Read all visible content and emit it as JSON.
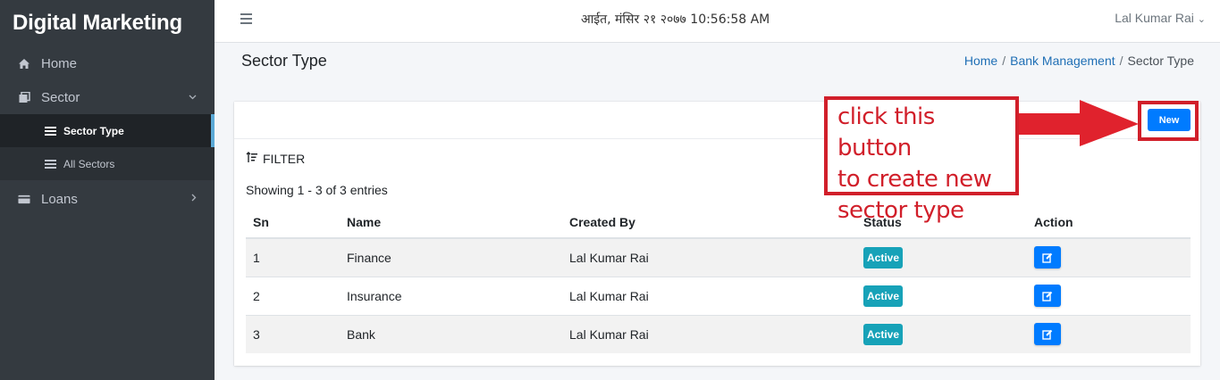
{
  "app": {
    "brand": "Digital Marketing"
  },
  "sidebar": {
    "items": [
      {
        "label": "Home",
        "icon": "home-icon"
      },
      {
        "label": "Sector",
        "icon": "copy-icon",
        "chevron": "chevron-down-icon"
      },
      {
        "label": "Loans",
        "icon": "credit-card-icon",
        "chevron": "chevron-right-icon"
      }
    ],
    "sub_items": [
      {
        "label": "Sector Type",
        "active": true
      },
      {
        "label": "All Sectors",
        "active": false
      }
    ]
  },
  "topbar": {
    "datetime": "आईत, मंसिर २१ २०७७ 10:56:58 AM",
    "user": "Lal Kumar Rai",
    "user_caret": "⌄"
  },
  "header": {
    "title": "Sector Type",
    "breadcrumb": [
      "Home",
      "Bank Management",
      "Sector Type"
    ]
  },
  "card": {
    "new_button": "New",
    "filter_label": "FILTER",
    "entries_text": "Showing 1 - 3 of 3 entries"
  },
  "table": {
    "columns": [
      "Sn",
      "Name",
      "Created By",
      "Status",
      "Action"
    ],
    "rows": [
      {
        "sn": "1",
        "name": "Finance",
        "created_by": "Lal Kumar Rai",
        "status": "Active"
      },
      {
        "sn": "2",
        "name": "Insurance",
        "created_by": "Lal Kumar Rai",
        "status": "Active"
      },
      {
        "sn": "3",
        "name": "Bank",
        "created_by": "Lal Kumar Rai",
        "status": "Active"
      }
    ]
  },
  "annotation": {
    "lines": [
      "click this button",
      "to create new",
      "sector type"
    ],
    "color": "#d11f2a"
  },
  "colors": {
    "sidebar_bg": "#343a40",
    "primary": "#007bff",
    "badge_active": "#17a2b8"
  }
}
